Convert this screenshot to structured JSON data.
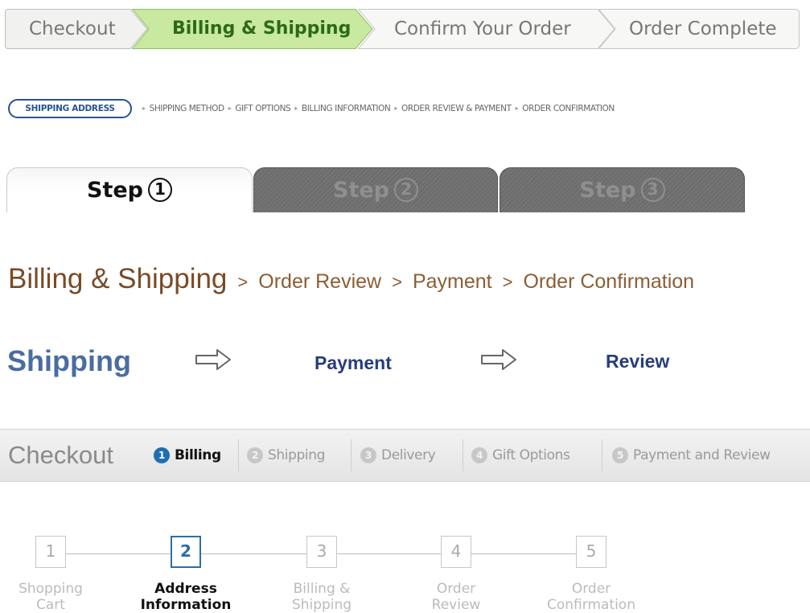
{
  "chevron_steps": [
    "Checkout",
    "Billing & Shipping",
    "Confirm Your Order",
    "Order Complete"
  ],
  "chevron_active_index": 1,
  "mini_breadcrumb": {
    "current": "SHIPPING ADDRESS",
    "items": [
      "SHIPPING METHOD",
      "GIFT OPTIONS",
      "BILLING INFORMATION",
      "ORDER REVIEW & PAYMENT",
      "ORDER CONFIRMATION"
    ],
    "separator": "▸"
  },
  "step_tabs": {
    "label": "Step",
    "numbers": [
      "1",
      "2",
      "3"
    ],
    "active_index": 0
  },
  "text_breadcrumb": {
    "current": "Billing & Shipping",
    "separator": ">",
    "items": [
      "Order Review",
      "Payment",
      "Order Confirmation"
    ]
  },
  "arrow_steps": {
    "items": [
      "Shipping",
      "Payment",
      "Review"
    ],
    "arrow": "⇨"
  },
  "checkout_bar": {
    "title": "Checkout",
    "steps": [
      {
        "num": "1",
        "label": "Billing"
      },
      {
        "num": "2",
        "label": "Shipping"
      },
      {
        "num": "3",
        "label": "Delivery"
      },
      {
        "num": "4",
        "label": "Gift Options"
      },
      {
        "num": "5",
        "label": "Payment and Review"
      }
    ],
    "active_index": 0
  },
  "numbered_steps": {
    "steps": [
      {
        "num": "1",
        "label": "Shopping\nCart"
      },
      {
        "num": "2",
        "label": "Address\nInformation"
      },
      {
        "num": "3",
        "label": "Billing &\nShipping"
      },
      {
        "num": "4",
        "label": "Order\nReview"
      },
      {
        "num": "5",
        "label": "Order\nConfirmation"
      }
    ],
    "active_index": 1
  },
  "colors": {
    "chevron_active_fill": "#c9e8a0",
    "chevron_active_text": "#2c6a16",
    "pill_blue": "#27548f",
    "breadcrumb_brown": "#7a4a25",
    "arrow_steps_blue": "#263d7a",
    "checkout_active_blue": "#1e6fb0",
    "numbered_active_blue": "#2d6ea3"
  }
}
